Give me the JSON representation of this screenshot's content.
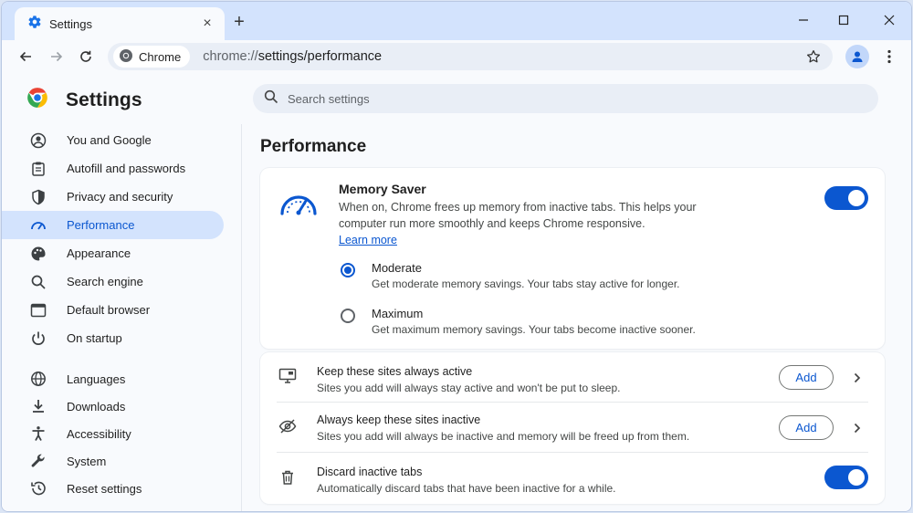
{
  "window": {
    "tab_title": "Settings",
    "new_tab_label": "+",
    "tab_close_label": "×"
  },
  "toolbar": {
    "chip_label": "Chrome",
    "url_scheme": "chrome://",
    "url_path": "settings/performance"
  },
  "header": {
    "title": "Settings",
    "search_placeholder": "Search settings"
  },
  "sidebar": {
    "items": [
      {
        "label": "You and Google",
        "icon": "account-circle-icon"
      },
      {
        "label": "Autofill and passwords",
        "icon": "clipboard-icon"
      },
      {
        "label": "Privacy and security",
        "icon": "shield-icon"
      },
      {
        "label": "Performance",
        "icon": "speedometer-icon",
        "active": true
      },
      {
        "label": "Appearance",
        "icon": "palette-icon"
      },
      {
        "label": "Search engine",
        "icon": "search-icon"
      },
      {
        "label": "Default browser",
        "icon": "browser-window-icon"
      },
      {
        "label": "On startup",
        "icon": "power-icon"
      },
      {
        "label": "Languages",
        "icon": "globe-icon"
      },
      {
        "label": "Downloads",
        "icon": "download-icon"
      },
      {
        "label": "Accessibility",
        "icon": "accessibility-icon"
      },
      {
        "label": "System",
        "icon": "wrench-icon"
      },
      {
        "label": "Reset settings",
        "icon": "history-icon"
      }
    ]
  },
  "main": {
    "page_title": "Performance",
    "memory_saver": {
      "title": "Memory Saver",
      "description": "When on, Chrome frees up memory from inactive tabs. This helps your computer run more smoothly and keeps Chrome responsive.",
      "learn_more": "Learn more",
      "enabled": true,
      "options": [
        {
          "label": "Moderate",
          "description": "Get moderate memory savings. Your tabs stay active for longer.",
          "selected": true
        },
        {
          "label": "Maximum",
          "description": "Get maximum memory savings. Your tabs become inactive sooner.",
          "selected": false
        }
      ]
    },
    "rows": [
      {
        "title": "Keep these sites always active",
        "description": "Sites you add will always stay active and won't be put to sleep.",
        "button": "Add",
        "icon": "monitor-icon"
      },
      {
        "title": "Always keep these sites inactive",
        "description": "Sites you add will always be inactive and memory will be freed up from them.",
        "button": "Add",
        "icon": "eye-off-icon"
      },
      {
        "title": "Discard inactive tabs",
        "description": "Automatically discard tabs that have been inactive for a while.",
        "enabled": true,
        "icon": "trash-icon"
      }
    ]
  },
  "colors": {
    "accent": "#0b57d0",
    "active_nav_bg": "#d3e3fd",
    "tabstrip_bg": "#d3e3fd",
    "page_bg": "#f8fafd"
  }
}
